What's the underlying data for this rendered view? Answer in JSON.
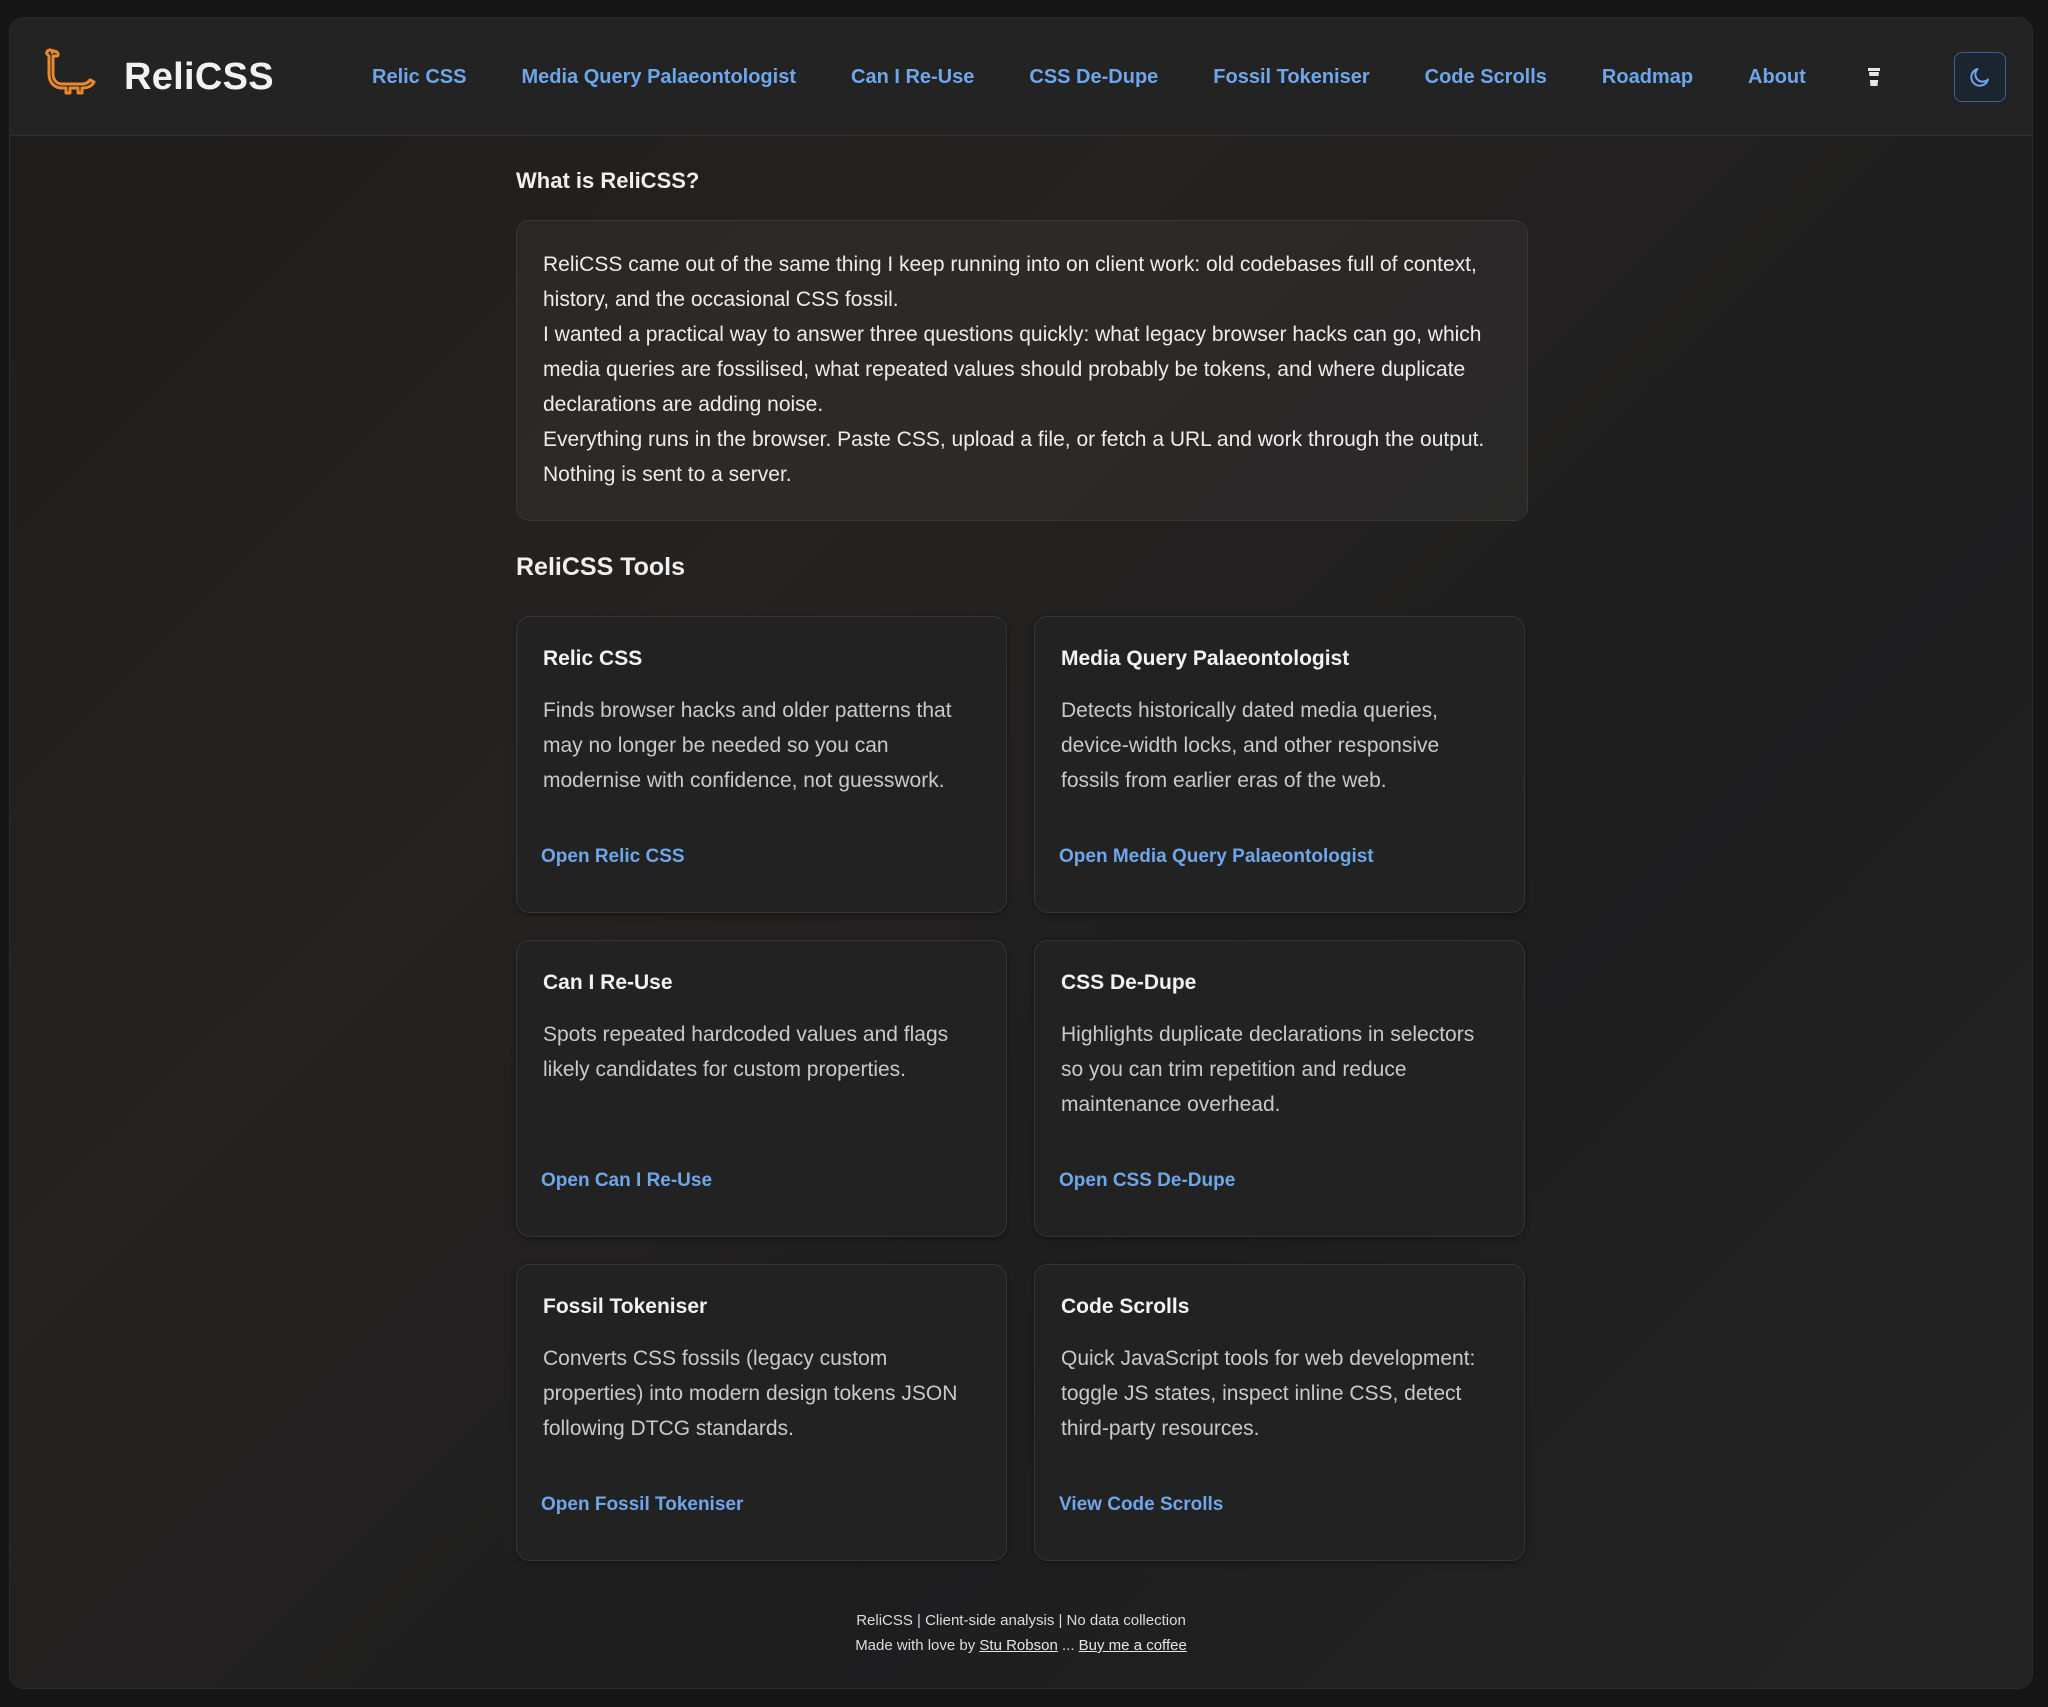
{
  "brand": {
    "name": "ReliCSS",
    "logo_icon": "dinosaur-icon",
    "accent": "#e8892b"
  },
  "nav": {
    "items": [
      {
        "label": "Relic CSS"
      },
      {
        "label": "Media Query Palaeontologist"
      },
      {
        "label": "Can I Re-Use"
      },
      {
        "label": "CSS De-Dupe"
      },
      {
        "label": "Fossil Tokeniser"
      },
      {
        "label": "Code Scrolls"
      },
      {
        "label": "Roadmap"
      },
      {
        "label": "About"
      }
    ],
    "coffee_icon": "coffee-cup-icon",
    "link_color": "#6ea6ea"
  },
  "theme_toggle": {
    "icon": "moon-icon"
  },
  "intro": {
    "heading": "What is ReliCSS?",
    "paragraphs": [
      "ReliCSS came out of the same thing I keep running into on client work: old codebases full of context, history, and the occasional CSS fossil.",
      "I wanted a practical way to answer three questions quickly: what legacy browser hacks can go, which media queries are fossilised, what repeated values should probably be tokens, and where duplicate declarations are adding noise.",
      "Everything runs in the browser. Paste CSS, upload a file, or fetch a URL and work through the output. Nothing is sent to a server."
    ]
  },
  "tools": {
    "heading": "ReliCSS Tools",
    "cards": [
      {
        "title": "Relic CSS",
        "description": "Finds browser hacks and older patterns that may no longer be needed so you can modernise with confidence, not guesswork.",
        "link": "Open Relic CSS"
      },
      {
        "title": "Media Query Palaeontologist",
        "description": "Detects historically dated media queries, device-width locks, and other responsive fossils from earlier eras of the web.",
        "link": "Open Media Query Palaeontologist"
      },
      {
        "title": "Can I Re-Use",
        "description": "Spots repeated hardcoded values and flags likely candidates for custom properties.",
        "link": "Open Can I Re-Use"
      },
      {
        "title": "CSS De-Dupe",
        "description": "Highlights duplicate declarations in selectors so you can trim repetition and reduce maintenance overhead.",
        "link": "Open CSS De-Dupe"
      },
      {
        "title": "Fossil Tokeniser",
        "description": "Converts CSS fossils (legacy custom properties) into modern design tokens JSON following DTCG standards.",
        "link": "Open Fossil Tokeniser"
      },
      {
        "title": "Code Scrolls",
        "description": "Quick JavaScript tools for web development: toggle JS states, inspect inline CSS, detect third-party resources.",
        "link": "View Code Scrolls"
      }
    ]
  },
  "footer": {
    "line1": "ReliCSS | Client-side analysis | No data collection",
    "made_with": "Made with love by",
    "author_link": "Stu Robson",
    "separator": "...",
    "coffee_link": "Buy me a coffee"
  }
}
